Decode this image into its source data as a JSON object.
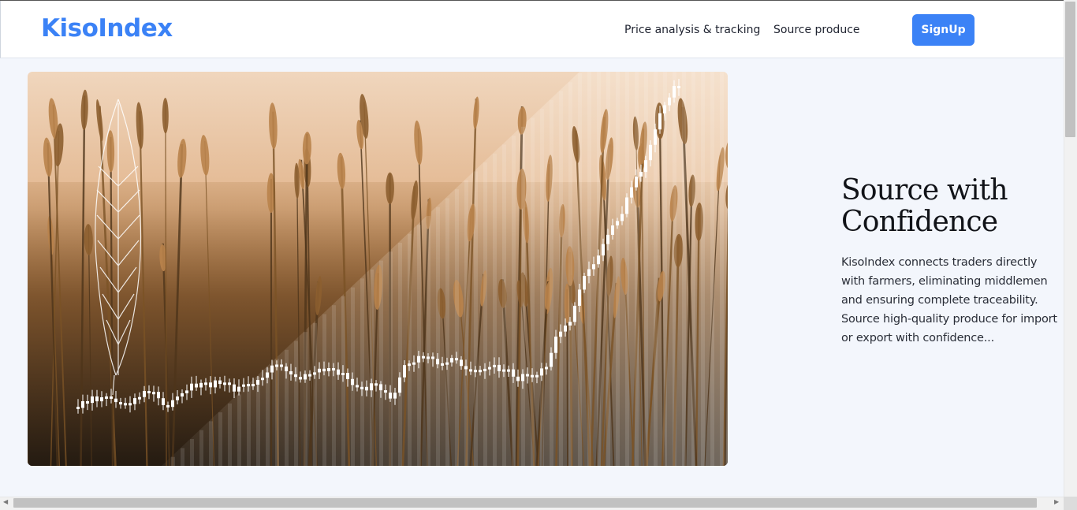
{
  "header": {
    "logo": "KisoIndex",
    "nav": [
      {
        "label": "Price analysis & tracking"
      },
      {
        "label": "Source produce"
      }
    ],
    "signup_label": "SignUp"
  },
  "hero": {
    "title": "Source with Confidence",
    "description": "KisoIndex connects traders directly with farmers, eliminating middlemen and ensuring complete traceability. Source high-quality produce for import or export with confidence..."
  },
  "colors": {
    "accent": "#3b82f6",
    "background": "#f3f6fc"
  },
  "icons": {
    "scroll_left": "chevron-left-icon",
    "scroll_right": "chevron-right-icon"
  }
}
